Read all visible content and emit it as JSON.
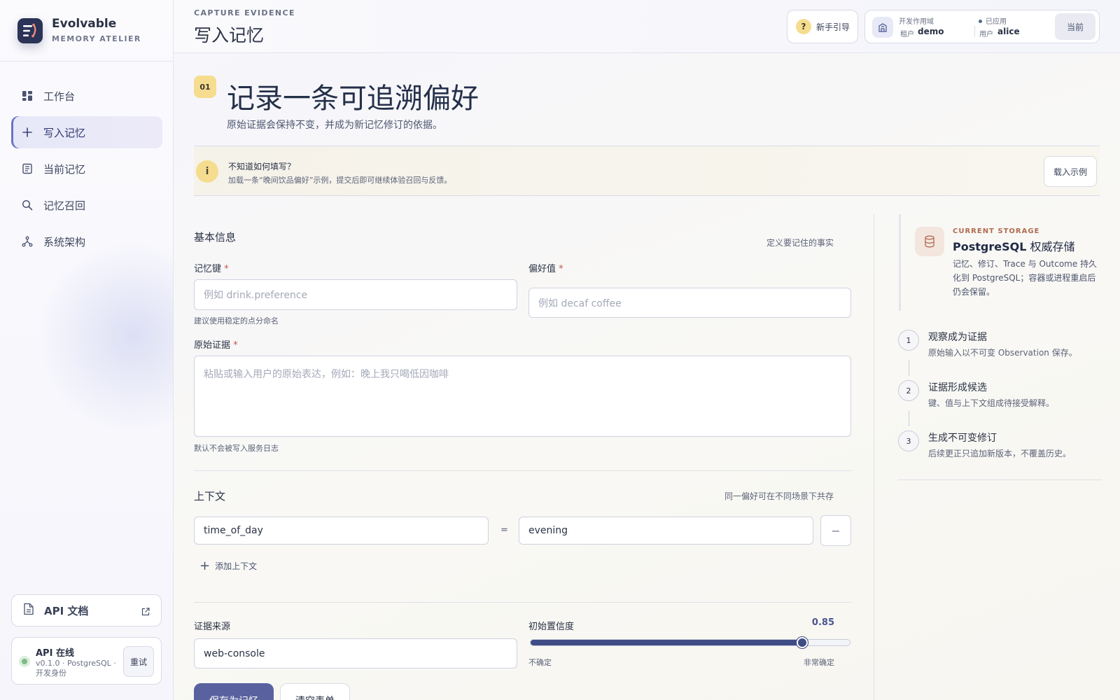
{
  "brand": {
    "name": "Evolvable",
    "subtitle": "MEMORY ATELIER"
  },
  "nav": [
    {
      "label": "工作台",
      "icon": "dashboard-icon"
    },
    {
      "label": "写入记忆",
      "icon": "plus-icon",
      "active": true
    },
    {
      "label": "当前记忆",
      "icon": "document-list-icon"
    },
    {
      "label": "记忆召回",
      "icon": "search-icon"
    },
    {
      "label": "系统架构",
      "icon": "network-icon"
    }
  ],
  "sidebar_footer": {
    "api_docs": "API 文档",
    "status_title": "API 在线",
    "status_meta": "v0.1.0 · PostgreSQL · 开发身份",
    "retry": "重试"
  },
  "header": {
    "eyebrow": "CAPTURE EVIDENCE",
    "title": "写入记忆",
    "guide": "新手引导",
    "domain_label": "开发作用域",
    "tenant_key": "租户",
    "tenant_value": "demo",
    "applied": "已应用",
    "user_key": "用户",
    "user_value": "alice",
    "current": "当前"
  },
  "hero": {
    "step": "01",
    "title": "记录一条可追溯偏好",
    "subtitle": "原始证据会保持不变，并成为新记忆修订的依据。"
  },
  "hint": {
    "icon_letter": "i",
    "title": "不知道如何填写？",
    "text": "加载一条“晚间饮品偏好”示例，提交后即可继续体验召回与反馈。",
    "button": "载入示例"
  },
  "basic": {
    "heading": "基本信息",
    "aside": "定义要记住的事实",
    "key_label": "记忆键",
    "key_placeholder": "例如 drink.preference",
    "key_help": "建议使用稳定的点分命名",
    "value_label": "偏好值",
    "value_placeholder": "例如 decaf coffee",
    "evidence_label": "原始证据",
    "evidence_placeholder": "粘贴或输入用户的原始表达，例如：晚上我只喝低因咖啡",
    "evidence_help": "默认不会被写入服务日志",
    "required_mark": "*"
  },
  "context": {
    "heading": "上下文",
    "aside": "同一偏好可在不同场景下共存",
    "key": "time_of_day",
    "equals": "=",
    "value": "evening",
    "remove": "−",
    "add": "添加上下文"
  },
  "source": {
    "label": "证据来源",
    "value": "web-console",
    "confidence_label": "初始置信度",
    "confidence": 0.85,
    "confidence_text": "0.85",
    "low": "不确定",
    "high": "非常确定"
  },
  "actions": {
    "save": "保存为记忆",
    "clear": "清空表单"
  },
  "storage": {
    "eyebrow": "CURRENT STORAGE",
    "title_strong": "PostgreSQL",
    "title_rest": " 权威存储",
    "desc": "记忆、修订、Trace 与 Outcome 持久化到 PostgreSQL；容器或进程重启后仍会保留。"
  },
  "steps": [
    {
      "num": "1",
      "title": "观察成为证据",
      "desc": "原始输入以不可变 Observation 保存。"
    },
    {
      "num": "2",
      "title": "证据形成候选",
      "desc": "键、值与上下文组成待接受解释。"
    },
    {
      "num": "3",
      "title": "生成不可变修订",
      "desc": "后续更正只追加新版本，不覆盖历史。"
    }
  ]
}
